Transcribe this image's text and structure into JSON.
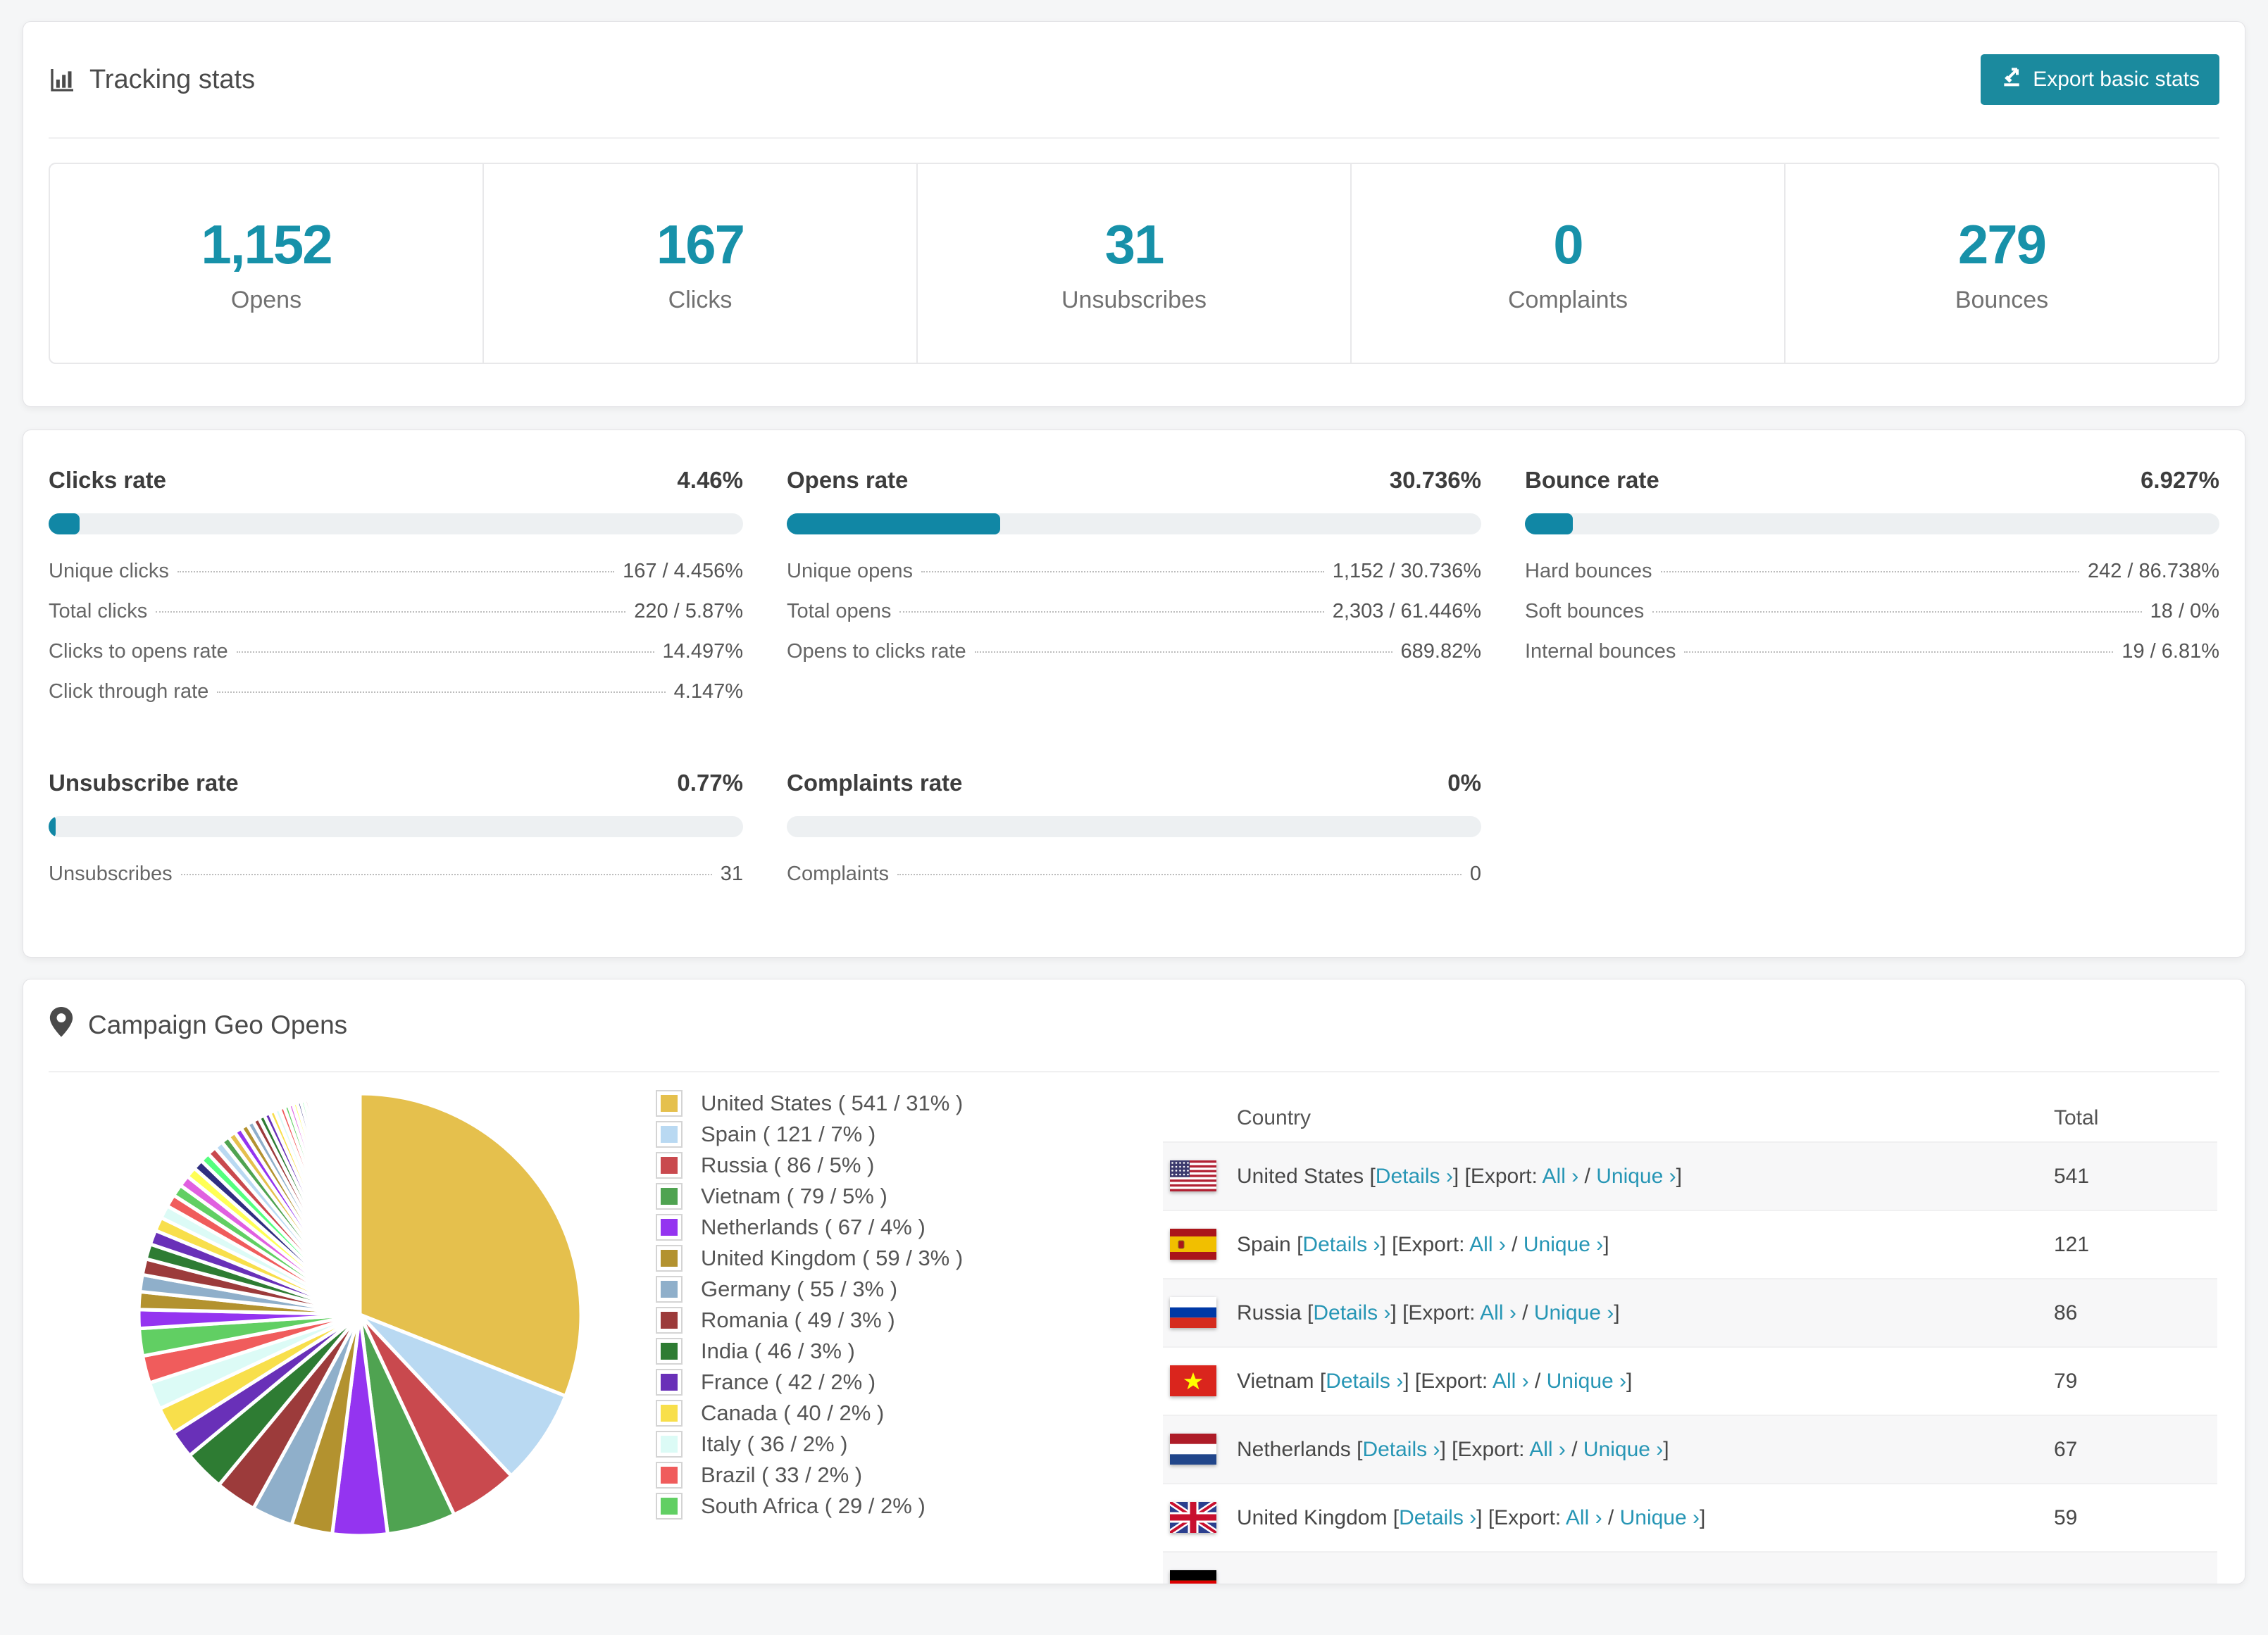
{
  "accent": "#1187a5",
  "button_bg": "#1b8a9e",
  "page_bg": "#f5f6f7",
  "tracking": {
    "title": "Tracking stats",
    "export_label": "Export basic stats"
  },
  "stats": [
    {
      "value": "1,152",
      "label": "Opens"
    },
    {
      "value": "167",
      "label": "Clicks"
    },
    {
      "value": "31",
      "label": "Unsubscribes"
    },
    {
      "value": "0",
      "label": "Complaints"
    },
    {
      "value": "279",
      "label": "Bounces"
    }
  ],
  "rates": [
    {
      "title": "Clicks rate",
      "value": "4.46%",
      "progress": 4.46,
      "rows": [
        {
          "label": "Unique clicks",
          "value": "167 / 4.456%"
        },
        {
          "label": "Total clicks",
          "value": "220 / 5.87%"
        },
        {
          "label": "Clicks to opens rate",
          "value": "14.497%"
        },
        {
          "label": "Click through rate",
          "value": "4.147%"
        }
      ]
    },
    {
      "title": "Opens rate",
      "value": "30.736%",
      "progress": 30.736,
      "rows": [
        {
          "label": "Unique opens",
          "value": "1,152 / 30.736%"
        },
        {
          "label": "Total opens",
          "value": "2,303 / 61.446%"
        },
        {
          "label": "Opens to clicks rate",
          "value": "689.82%"
        }
      ]
    },
    {
      "title": "Bounce rate",
      "value": "6.927%",
      "progress": 6.927,
      "rows": [
        {
          "label": "Hard bounces",
          "value": "242 / 86.738%"
        },
        {
          "label": "Soft bounces",
          "value": "18 / 0%"
        },
        {
          "label": "Internal bounces",
          "value": "19 / 6.81%"
        }
      ]
    },
    {
      "title": "Unsubscribe rate",
      "value": "0.77%",
      "progress": 0.77,
      "rows": [
        {
          "label": "Unsubscribes",
          "value": "31"
        }
      ]
    },
    {
      "title": "Complaints rate",
      "value": "0%",
      "progress": 0,
      "rows": [
        {
          "label": "Complaints",
          "value": "0"
        }
      ]
    }
  ],
  "geo": {
    "title": "Campaign Geo Opens",
    "table_headers": {
      "country": "Country",
      "total": "Total"
    },
    "link_labels": {
      "details": "Details ›",
      "export_prefix": "Export:",
      "all": "All ›",
      "unique": "Unique ›"
    },
    "rows": [
      {
        "country": "United States",
        "flag": "us",
        "total": "541"
      },
      {
        "country": "Spain",
        "flag": "es",
        "total": "121"
      },
      {
        "country": "Russia",
        "flag": "ru",
        "total": "86"
      },
      {
        "country": "Vietnam",
        "flag": "vn",
        "total": "79"
      },
      {
        "country": "Netherlands",
        "flag": "nl",
        "total": "67"
      },
      {
        "country": "United Kingdom",
        "flag": "gb",
        "total": "59"
      },
      {
        "country": "Germany",
        "flag": "de",
        "total": "",
        "partial": true
      }
    ]
  },
  "chart_data": {
    "type": "pie",
    "title": "Campaign Geo Opens",
    "categories": [
      "United States",
      "Spain",
      "Russia",
      "Vietnam",
      "Netherlands",
      "United Kingdom",
      "Germany",
      "Romania",
      "India",
      "France",
      "Canada",
      "Italy",
      "Brazil",
      "South Africa"
    ],
    "values": [
      541,
      121,
      86,
      79,
      67,
      59,
      55,
      49,
      46,
      42,
      40,
      36,
      33,
      29
    ],
    "percents": [
      31,
      7,
      5,
      5,
      4,
      3,
      3,
      3,
      3,
      2,
      2,
      2,
      2,
      2
    ],
    "colors": [
      "#E5C04D",
      "#B9D9F2",
      "#C9494E",
      "#4FA351",
      "#9434F0",
      "#B3922F",
      "#8FAFCA",
      "#9C3B3B",
      "#2E7C33",
      "#6930B8",
      "#F8DF4B",
      "#DCFBF6",
      "#F05C5C",
      "#61CF63"
    ],
    "legend_labels": [
      "United States ( 541 / 31% )",
      "Spain ( 121 / 7% )",
      "Russia ( 86 / 5% )",
      "Vietnam ( 79 / 5% )",
      "Netherlands ( 67 / 4% )",
      "United Kingdom ( 59 / 3% )",
      "Germany ( 55 / 3% )",
      "Romania ( 49 / 3% )",
      "India ( 46 / 3% )",
      "France ( 42 / 2% )",
      "Canada ( 40 / 2% )",
      "Italy ( 36 / 2% )",
      "Brazil ( 33 / 2% )",
      "South Africa ( 29 / 2% )"
    ],
    "others_percent": 26,
    "tail_colors": [
      "#9434F0",
      "#B3922F",
      "#8FAFCA",
      "#9C3B3B",
      "#2E7C33",
      "#6930B8",
      "#F8DF4B",
      "#DCFBF6",
      "#F05C5C",
      "#61CF63",
      "#E060E0",
      "#FFFF55",
      "#2F2F80",
      "#55FF7F",
      "#C9494E",
      "#B9D9F2",
      "#4FA351",
      "#E5C04D"
    ],
    "legend_position": "right",
    "start_angle_deg": -90,
    "direction": "clockwise"
  }
}
